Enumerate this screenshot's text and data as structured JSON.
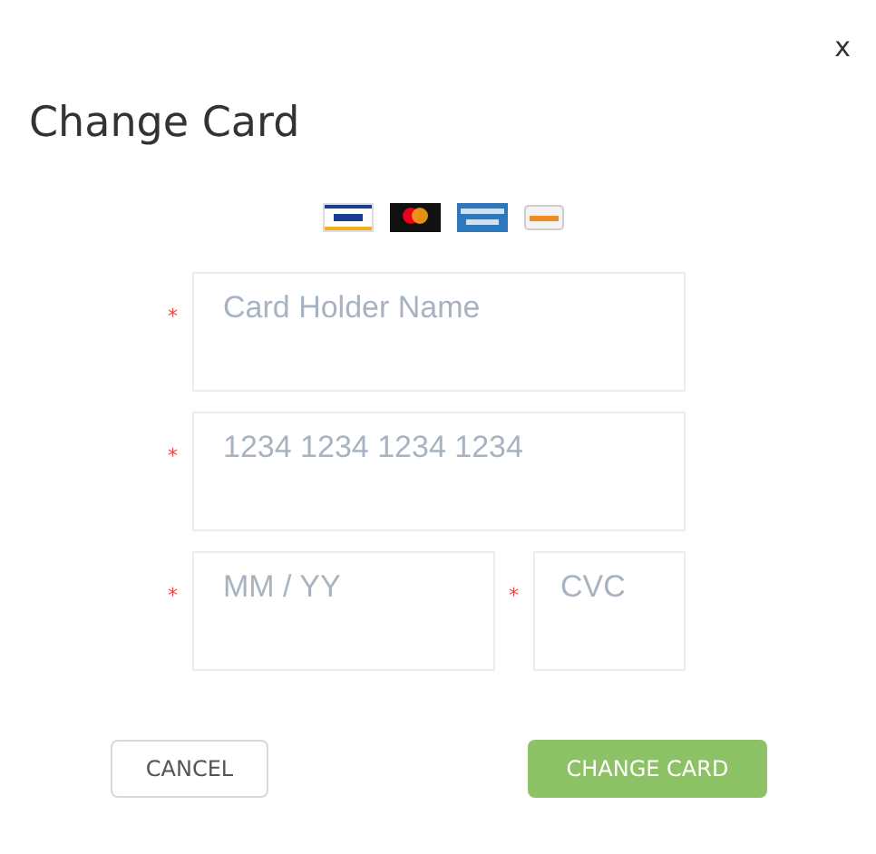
{
  "close_label": "x",
  "title": "Change Card",
  "card_brands": [
    {
      "kind": "visa"
    },
    {
      "kind": "mastercard"
    },
    {
      "kind": "amex"
    },
    {
      "kind": "discover"
    }
  ],
  "fields": [
    {
      "placeholder": "Card Holder Name",
      "required": true,
      "marker": "*"
    },
    {
      "placeholder": "1234 1234 1234 1234",
      "required": true,
      "marker": "*"
    }
  ],
  "expiry": {
    "placeholder": "MM / YY",
    "required": true,
    "marker": "*"
  },
  "cvc": {
    "placeholder": "CVC",
    "required": true,
    "marker": "*"
  },
  "buttons": {
    "cancel": "CANCEL",
    "submit": "CHANGE CARD"
  }
}
